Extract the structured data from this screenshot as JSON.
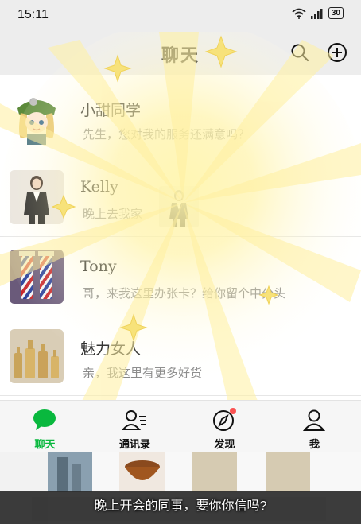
{
  "status_bar": {
    "time": "15:11",
    "battery": "30"
  },
  "nav": {
    "title": "聊天"
  },
  "chats": [
    {
      "name": "小甜同学",
      "preview": "先生，您对我的服务还满意吗？"
    },
    {
      "name": "Kelly",
      "preview": "晚上去我家"
    },
    {
      "name": "Tony",
      "preview": "哥，来我这里办张卡？给你留个中分头"
    },
    {
      "name": "魅力女人",
      "preview": "亲，我这里有更多好货"
    }
  ],
  "tabs": [
    {
      "label": "聊天",
      "active": true
    },
    {
      "label": "通讯录",
      "active": false
    },
    {
      "label": "发现",
      "active": false,
      "badge": true
    },
    {
      "label": "我",
      "active": false
    }
  ],
  "caption": "晚上开会的同事，要你你信吗?",
  "colors": {
    "accent": "#09b83e",
    "badge": "#fa5151",
    "bar": "#ededed"
  }
}
